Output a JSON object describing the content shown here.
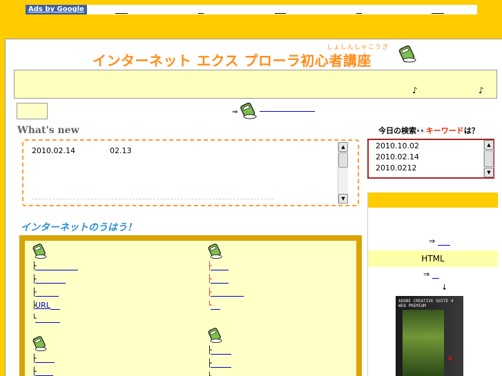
{
  "ads": {
    "label": "Ads by Google",
    "links": [
      {
        "id": 1
      },
      {
        "id": 2
      },
      {
        "id": 3
      },
      {
        "id": 4
      },
      {
        "id": 5
      }
    ]
  },
  "header": {
    "title": "インターネット エクス プローラ初心者講座",
    "ruby": "しょしんしゃこうざ"
  },
  "notice": {
    "note1": "♪",
    "note2": "♪"
  },
  "bookline": {
    "arrow": "⇒"
  },
  "whatsnew": {
    "title": "What's new",
    "items": [
      {
        "date": "2010.02.14",
        "text": "02.13"
      }
    ]
  },
  "today": {
    "title_prefix": "今日の検索",
    "title_keyword": "キーワード",
    "title_suffix": "は？",
    "rows": [
      "2010.10.02",
      "2010.02.14",
      "2010.0212"
    ]
  },
  "right": {
    "arrow1": "⇒",
    "html_label": "HTML",
    "arrow2": "⇒",
    "down": "↓",
    "product_text": "ADOBE CREATIVE SUITE 4\nWEB PREMIUM"
  },
  "section": {
    "title": "インターネットのうはう！"
  },
  "categories": {
    "left_top": {
      "items": [
        {
          "tree": "├",
          "kind": "link"
        },
        {
          "tree": "├",
          "kind": "link"
        },
        {
          "tree": "├",
          "kind": "link"
        },
        {
          "tree": "├",
          "label": "URL",
          "kind": "url"
        },
        {
          "tree": "└",
          "kind": "link"
        }
      ]
    },
    "right_top": {
      "items": [
        {
          "tree": "├",
          "kind": "link"
        },
        {
          "tree": "├",
          "kind": "link"
        },
        {
          "tree": "├",
          "kind": "link"
        },
        {
          "tree": "└",
          "kind": "link"
        }
      ]
    },
    "left_bottom": {
      "items": [
        {
          "tree": "├",
          "kind": "link"
        },
        {
          "tree": "├",
          "kind": "link"
        }
      ]
    },
    "right_bottom": {
      "items": [
        {
          "tree": "├",
          "kind": "link"
        },
        {
          "tree": "├",
          "kind": "link"
        },
        {
          "tree": "└",
          "kind": "link"
        }
      ]
    }
  },
  "colors": {
    "page_bg": "#ffcc00",
    "title_orange": "#ff8c1a",
    "section_blue": "#2a8fd4",
    "keyword_red": "#e62e00",
    "category_frame": "#d9a300",
    "notice_bg": "#ffffc0"
  },
  "icons": {
    "book": "green-book-icon",
    "scroll_up": "arrow-up-icon",
    "scroll_down": "arrow-down-icon"
  }
}
